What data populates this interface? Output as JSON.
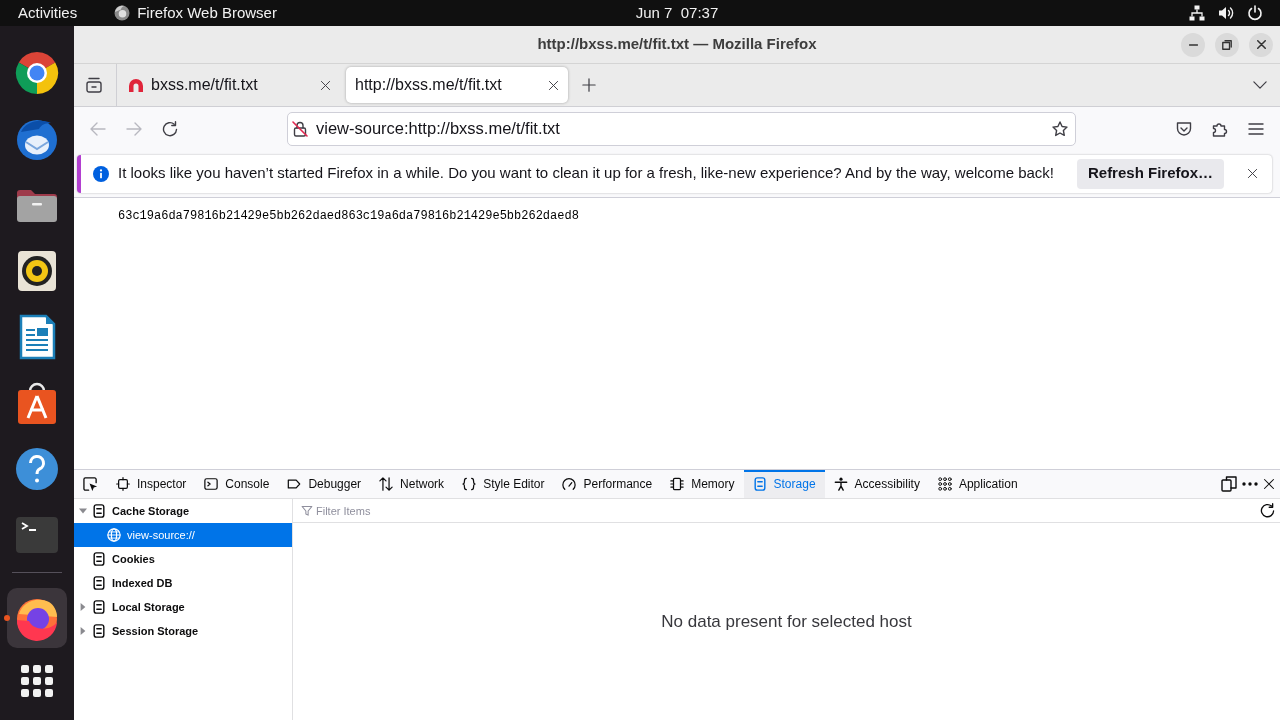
{
  "top_bar": {
    "activities": "Activities",
    "app_name": "Firefox Web Browser",
    "clock": "Jun 7  07:37"
  },
  "dock": {
    "pinned": [
      {
        "kind": "chrome",
        "active": false
      },
      {
        "kind": "thunderbird",
        "active": false
      },
      {
        "kind": "files",
        "active": false
      },
      {
        "kind": "rhythmbox",
        "active": false
      },
      {
        "kind": "writer",
        "active": false
      },
      {
        "kind": "software",
        "active": false
      },
      {
        "kind": "help",
        "active": false
      },
      {
        "kind": "terminal",
        "active": false
      }
    ],
    "running": [
      {
        "kind": "firefox",
        "active": true
      }
    ]
  },
  "window": {
    "title": "http://bxss.me/t/fit.txt — Mozilla Firefox"
  },
  "tabs": [
    {
      "label": "bxss.me/t/fit.txt",
      "favicon": true,
      "selected": false
    },
    {
      "label": "http://bxss.me/t/fit.txt",
      "favicon": false,
      "selected": true
    }
  ],
  "navigation": {
    "back": {
      "disabled": true
    },
    "forward": {
      "disabled": true
    },
    "secure": false,
    "url": "view-source:http://bxss.me/t/fit.txt"
  },
  "notification": {
    "message": "It looks like you haven’t started Firefox in a while. Do you want to clean it up for a fresh, like-new experience? And by the way, welcome back!",
    "button": "Refresh Firefox…"
  },
  "page": {
    "text": "63c19a6da79816b21429e5bb262daed863c19a6da79816b21429e5bb262daed8"
  },
  "devtools": {
    "tabs": [
      {
        "kind": "inspector",
        "label": "Inspector",
        "selected": false
      },
      {
        "kind": "console",
        "label": "Console",
        "selected": false
      },
      {
        "kind": "debugger",
        "label": "Debugger",
        "selected": false
      },
      {
        "kind": "network",
        "label": "Network",
        "selected": false
      },
      {
        "kind": "style_editor",
        "label": "Style Editor",
        "selected": false
      },
      {
        "kind": "performance",
        "label": "Performance",
        "selected": false
      },
      {
        "kind": "memory",
        "label": "Memory",
        "selected": false
      },
      {
        "kind": "storage",
        "label": "Storage",
        "selected": true
      },
      {
        "kind": "accessibility",
        "label": "Accessibility",
        "selected": false
      },
      {
        "kind": "application",
        "label": "Application",
        "selected": false
      }
    ],
    "tree": [
      {
        "kind": "store",
        "label": "Cache Storage",
        "expandable": true,
        "expanded": true,
        "selected": false,
        "children": [
          {
            "kind": "origin",
            "label": "view-source://",
            "expandable": false,
            "selected": true
          }
        ]
      },
      {
        "kind": "store",
        "label": "Cookies",
        "expandable": false,
        "selected": false
      },
      {
        "kind": "store",
        "label": "Indexed DB",
        "expandable": false,
        "selected": false
      },
      {
        "kind": "store",
        "label": "Local Storage",
        "expandable": true,
        "expanded": false,
        "selected": false
      },
      {
        "kind": "store",
        "label": "Session Storage",
        "expandable": true,
        "expanded": false,
        "selected": false
      }
    ],
    "filter": {
      "placeholder": "Filter Items"
    },
    "empty_message": "No data present for selected host"
  }
}
